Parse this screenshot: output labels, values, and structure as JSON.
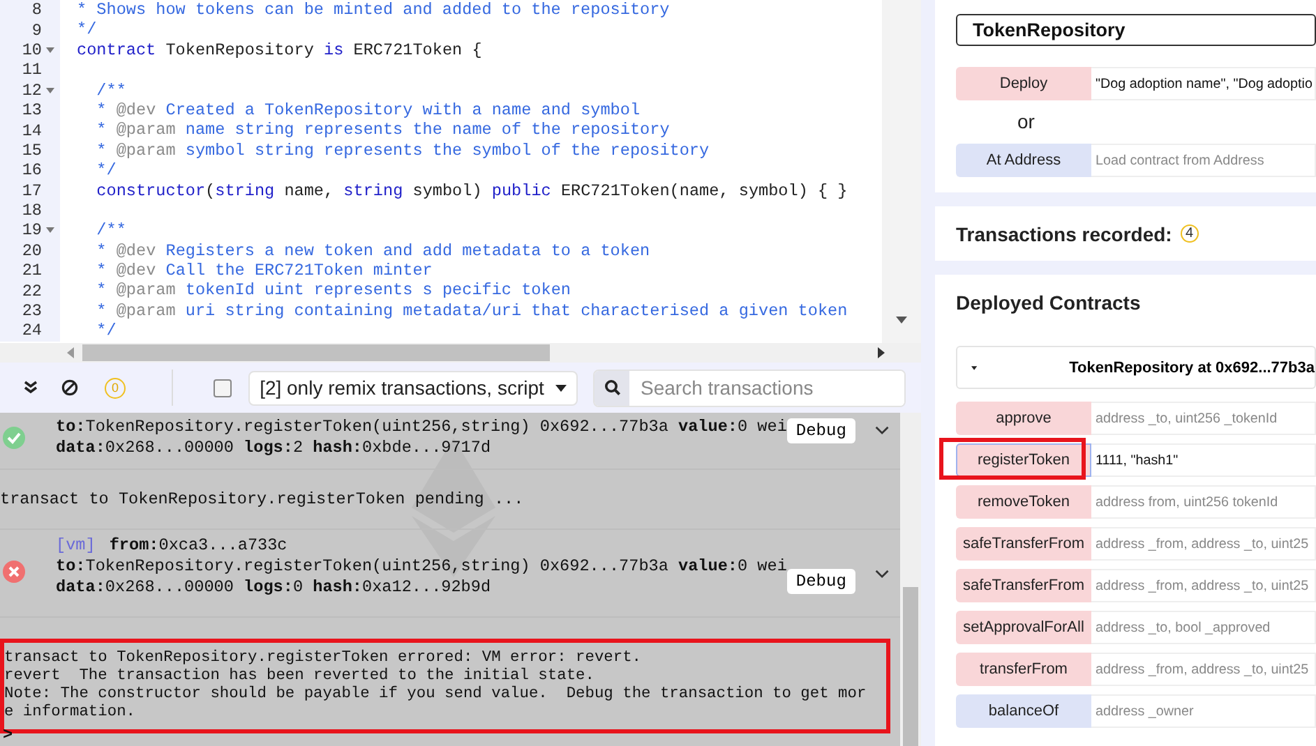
{
  "editor": {
    "lines": [
      {
        "number": "8",
        "fold": false,
        "tokens": [
          {
            "kind": "doc",
            "text": "* Shows how tokens can be minted and added to the repository"
          }
        ]
      },
      {
        "number": "9",
        "fold": false,
        "tokens": [
          {
            "kind": "doc",
            "text": "*/"
          }
        ]
      },
      {
        "number": "10",
        "fold": true,
        "tokens": [
          {
            "kind": "kw",
            "text": "contract"
          },
          {
            "kind": "plain",
            "text": " TokenRepository "
          },
          {
            "kind": "kw",
            "text": "is"
          },
          {
            "kind": "plain",
            "text": " ERC721Token {"
          }
        ]
      },
      {
        "number": "11",
        "fold": false
      },
      {
        "number": "12",
        "fold": true,
        "tokens": [
          {
            "kind": "doc",
            "text": "  /**"
          }
        ]
      },
      {
        "number": "13",
        "fold": false,
        "tokens": [
          {
            "kind": "doc",
            "text": "  * "
          },
          {
            "kind": "tag",
            "text": "@dev"
          },
          {
            "kind": "doc",
            "text": " Created a TokenRepository with a name and symbol"
          }
        ]
      },
      {
        "number": "14",
        "fold": false,
        "tokens": [
          {
            "kind": "doc",
            "text": "  * "
          },
          {
            "kind": "tag",
            "text": "@param"
          },
          {
            "kind": "doc",
            "text": " name string represents the name of the repository"
          }
        ]
      },
      {
        "number": "15",
        "fold": false,
        "tokens": [
          {
            "kind": "doc",
            "text": "  * "
          },
          {
            "kind": "tag",
            "text": "@param"
          },
          {
            "kind": "doc",
            "text": " symbol string represents the symbol of the repository"
          }
        ]
      },
      {
        "number": "16",
        "fold": false,
        "tokens": [
          {
            "kind": "doc",
            "text": "  */"
          }
        ]
      },
      {
        "number": "17",
        "fold": false,
        "tokens": [
          {
            "kind": "kw",
            "text": "  constructor"
          },
          {
            "kind": "plain",
            "text": "("
          },
          {
            "kind": "kw",
            "text": "string"
          },
          {
            "kind": "plain",
            "text": " name, "
          },
          {
            "kind": "kw",
            "text": "string"
          },
          {
            "kind": "plain",
            "text": " symbol) "
          },
          {
            "kind": "kw",
            "text": "public"
          },
          {
            "kind": "plain",
            "text": " ERC721Token(name, symbol) { }"
          }
        ]
      },
      {
        "number": "18",
        "fold": false
      },
      {
        "number": "19",
        "fold": true,
        "tokens": [
          {
            "kind": "doc",
            "text": "  /**"
          }
        ]
      },
      {
        "number": "20",
        "fold": false,
        "tokens": [
          {
            "kind": "doc",
            "text": "  * "
          },
          {
            "kind": "tag",
            "text": "@dev"
          },
          {
            "kind": "doc",
            "text": " Registers a new token and add metadata to a token"
          }
        ]
      },
      {
        "number": "21",
        "fold": false,
        "tokens": [
          {
            "kind": "doc",
            "text": "  * "
          },
          {
            "kind": "tag",
            "text": "@dev"
          },
          {
            "kind": "doc",
            "text": " Call the ERC721Token minter"
          }
        ]
      },
      {
        "number": "22",
        "fold": false,
        "tokens": [
          {
            "kind": "doc",
            "text": "  * "
          },
          {
            "kind": "tag",
            "text": "@param"
          },
          {
            "kind": "doc",
            "text": " tokenId uint represents s pecific token"
          }
        ]
      },
      {
        "number": "23",
        "fold": false,
        "tokens": [
          {
            "kind": "doc",
            "text": "  * "
          },
          {
            "kind": "tag",
            "text": "@param"
          },
          {
            "kind": "doc",
            "text": " uri string containing metadata/uri that characterised a given token"
          }
        ]
      },
      {
        "number": "24",
        "fold": false,
        "tokens": [
          {
            "kind": "doc",
            "text": "  */"
          }
        ]
      }
    ]
  },
  "terminal": {
    "pending_count": "0",
    "filter_checked": false,
    "filter": "[2] only remix transactions, script",
    "search": {
      "placeholder": "Search transactions"
    },
    "entries": [
      {
        "kind": "tx",
        "failed": false,
        "lines": [
          "**to:**TokenRepository.registerToken(uint256,string) 0x692...77b3a **value:**0 wei",
          "**data:**0x268...00000 **logs:**2 **hash:**0xbde...9717d"
        ],
        "button": "Debug"
      },
      {
        "kind": "log",
        "text": "transact to TokenRepository.registerToken pending ..."
      },
      {
        "kind": "tx",
        "failed": true,
        "tag": "[vm]",
        "lines": [
          "**from:**0xca3...a733c",
          "**to:**TokenRepository.registerToken(uint256,string) 0x692...77b3a **value:**0 wei",
          "**data:**0x268...00000 **logs:**0 **hash:**0xa12...92b9d"
        ],
        "button": "Debug"
      },
      {
        "kind": "error",
        "annotated": true,
        "text": "transact to TokenRepository.registerToken errored: VM error: revert.\nrevert\tThe transaction has been reverted to the initial state.\nNote: The constructor should be payable if you send value.\tDebug the transaction to get mor\ne information."
      }
    ],
    "prompt": ">"
  },
  "run": {
    "contract": "TokenRepository",
    "deploy": {
      "label": "Deploy",
      "value": "\"Dog adoption name\", \"Dog adoptio"
    },
    "or": "or",
    "at_address": {
      "label": "At Address",
      "placeholder": "Load contract from Address"
    },
    "transactions": {
      "label": "Transactions recorded:",
      "count": "4"
    },
    "deployed": {
      "title": "Deployed Contracts",
      "instance": "TokenRepository at 0x692...77b3a",
      "expanded": true,
      "functions": [
        {
          "label": "approve",
          "kind": "transact",
          "placeholder": "address _to, uint256 _tokenId",
          "focused": false,
          "annotated": false
        },
        {
          "label": "registerToken",
          "kind": "transact",
          "value": "1111, \"hash1\"",
          "focused": true,
          "annotated": true
        },
        {
          "label": "removeToken",
          "kind": "transact",
          "placeholder": "address from, uint256 tokenId",
          "focused": false,
          "annotated": false
        },
        {
          "label": "safeTransferFrom",
          "kind": "transact",
          "placeholder": "address _from, address _to, uint25",
          "focused": false,
          "annotated": false
        },
        {
          "label": "safeTransferFrom",
          "kind": "transact",
          "placeholder": "address _from, address _to, uint25",
          "focused": false,
          "annotated": false
        },
        {
          "label": "setApprovalForAll",
          "kind": "transact",
          "placeholder": "address _to, bool _approved",
          "focused": false,
          "annotated": false
        },
        {
          "label": "transferFrom",
          "kind": "transact",
          "placeholder": "address _from, address _to, uint25",
          "focused": false,
          "annotated": false
        },
        {
          "label": "balanceOf",
          "kind": "call",
          "placeholder": "address _owner",
          "focused": false,
          "annotated": false
        }
      ]
    }
  }
}
